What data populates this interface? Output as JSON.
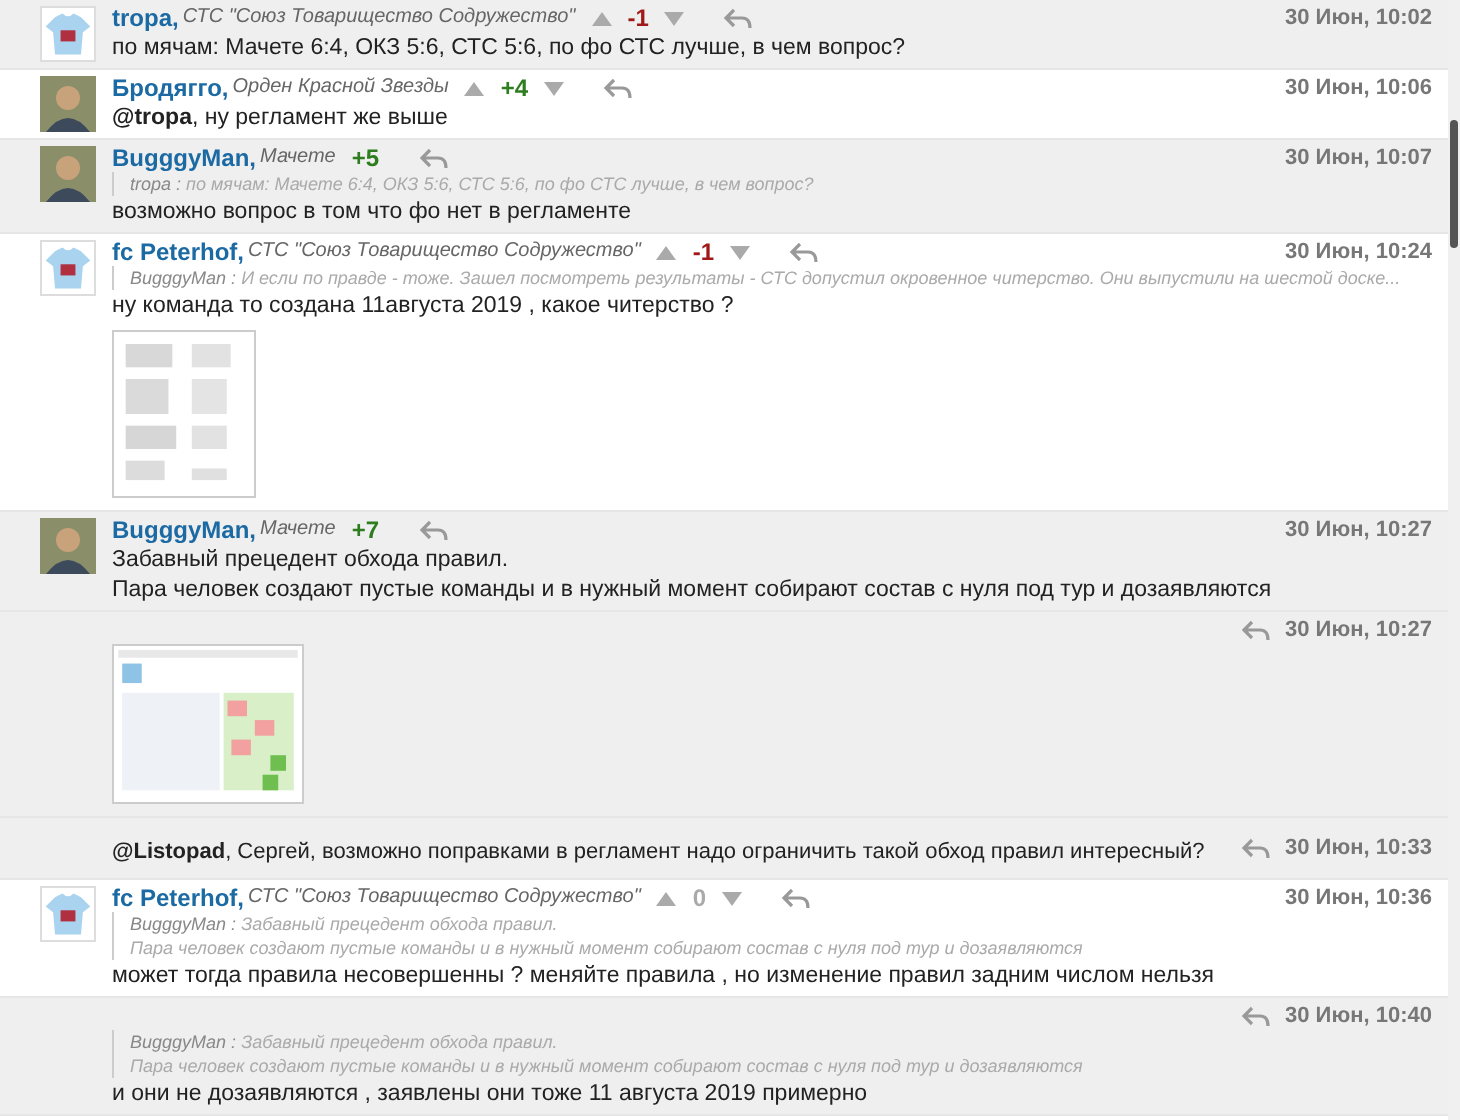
{
  "posts": [
    {
      "shaded": true,
      "avatar": {
        "kind": "jersey"
      },
      "author": "tropa,",
      "team": "СТС \"Союз Товарищество Содружество\"",
      "votable": true,
      "score": "-1",
      "color": "#a01818",
      "date": "30 Июн, 10:02",
      "text": "по мячам: Мачете 6:4, ОКЗ 5:6, СТС 5:6, по фо СТС лучше, в чем вопрос?"
    },
    {
      "shaded": false,
      "avatar": {
        "kind": "person"
      },
      "author": "Бродягго,",
      "team": "Орден Красной Звезды",
      "votable": true,
      "score": "+4",
      "color": "#2e7d1e",
      "date": "30 Июн, 10:06",
      "text": "**@tropa**, ну регламент же выше"
    },
    {
      "shaded": true,
      "avatar": {
        "kind": "person"
      },
      "author": "BugggyMan,",
      "team": "Мачете",
      "votable": false,
      "score": "+5",
      "color": "#2e7d1e",
      "date": "30 Июн, 10:07",
      "quote": {
        "author": "tropa :",
        "lines": [
          "по мячам: Мачете 6:4, ОКЗ 5:6, СТС 5:6, по фо СТС лучше, в чем вопрос?"
        ]
      },
      "text": "возможно вопрос в том что фо нет в регламенте"
    },
    {
      "shaded": false,
      "avatar": {
        "kind": "jersey"
      },
      "author": "fc Peterhof,",
      "team": "СТС \"Союз Товарищество Содружество\"",
      "votable": true,
      "score": "-1",
      "color": "#a01818",
      "date": "30 Июн, 10:24",
      "quote": {
        "author": "BugggyMan :",
        "lines": [
          "И если по правде - тоже. Зашел посмотреть результаты - СТС допустил окровенное читерство. Они выпустили на шестой доске..."
        ]
      },
      "text": "ну команда то создана 11августа 2019 , какое читерство ?"
    },
    {
      "shaded": true,
      "avatar": {
        "kind": "person"
      },
      "author": "BugggyMan,",
      "team": "Мачете",
      "votable": false,
      "score": "+7",
      "color": "#2e7d1e",
      "date": "30 Июн, 10:27",
      "text": "Забавный прецедент обхода правил.\nПара человек создают пустые команды и в нужный момент собирают состав с нуля под тур и дозаявляются"
    },
    {
      "shaded": true,
      "date": "30 Июн, 10:27"
    },
    {
      "shaded": true,
      "date": "30 Июн, 10:33",
      "text": "**@Listopad**, Сергей, возможно поправками в регламент надо ограничить такой обход правил интересный?"
    },
    {
      "shaded": false,
      "avatar": {
        "kind": "jersey"
      },
      "author": "fc Peterhof,",
      "team": "СТС \"Союз Товарищество Содружество\"",
      "votable": true,
      "score": "0",
      "color": "#aaaaaa",
      "date": "30 Июн, 10:36",
      "quote": {
        "author": "BugggyMan :",
        "lines": [
          "Забавный прецедент обхода правил.",
          "Пара человек создают пустые команды и в нужный момент собирают состав с нуля под тур и дозаявляются"
        ]
      },
      "text": "может тогда правила несовершенны ? меняйте правила , но изменение правил задним числом нельзя"
    },
    {
      "shaded": true,
      "date": "30 Июн, 10:40",
      "quote": {
        "author": "BugggyMan :",
        "lines": [
          "Забавный прецедент обхода правил.",
          "Пара человек создают пустые команды и в нужный момент собирают состав с нуля под тур и дозаявляются"
        ]
      },
      "text": "и они не дозаявляются , заявлены они тоже 11 августа 2019 примерно"
    }
  ]
}
